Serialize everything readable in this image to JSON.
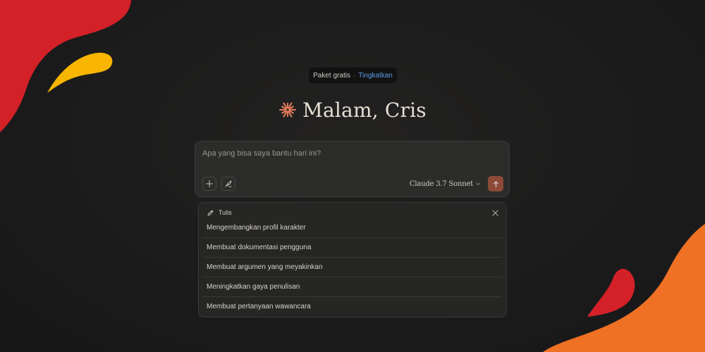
{
  "plan": {
    "label": "Paket gratis",
    "separator": "·",
    "upgrade_label": "Tingkatkan"
  },
  "greeting": {
    "text": "Malam, Cris",
    "icon": "spark-logo-icon"
  },
  "composer": {
    "placeholder": "Apa yang bisa saya bantu hari ini?",
    "model_name": "Claude 3.7 Sonnet"
  },
  "suggestions": {
    "title": "Tulis",
    "items": [
      "Mengembangkan profil karakter",
      "Membuat dokumentasi pengguna",
      "Membuat argumen yang meyakinkan",
      "Meningkatkan gaya penulisan",
      "Membuat pertanyaan wawancara"
    ]
  },
  "colors": {
    "background": "#1c1c1c",
    "accent": "#d97757",
    "send_button": "#8c4a37",
    "link": "#5e9ce6",
    "decor_red": "#d42027",
    "decor_yellow": "#f7b500",
    "decor_orange": "#f07024"
  }
}
